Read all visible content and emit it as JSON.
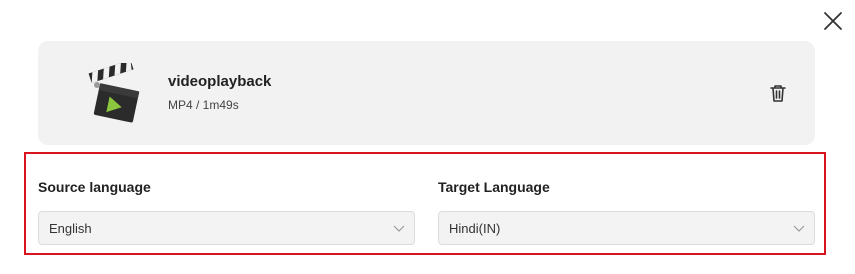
{
  "dialog": {
    "close_icon": "close-icon"
  },
  "file": {
    "name": "videoplayback",
    "meta": "MP4 / 1m49s",
    "thumbnail_icon": "clapperboard-icon",
    "delete_icon": "trash-icon"
  },
  "languages": {
    "source": {
      "label": "Source language",
      "value": "English"
    },
    "target": {
      "label": "Target Language",
      "value": "Hindi(IN)"
    },
    "highlight_color": "#d9141e"
  }
}
